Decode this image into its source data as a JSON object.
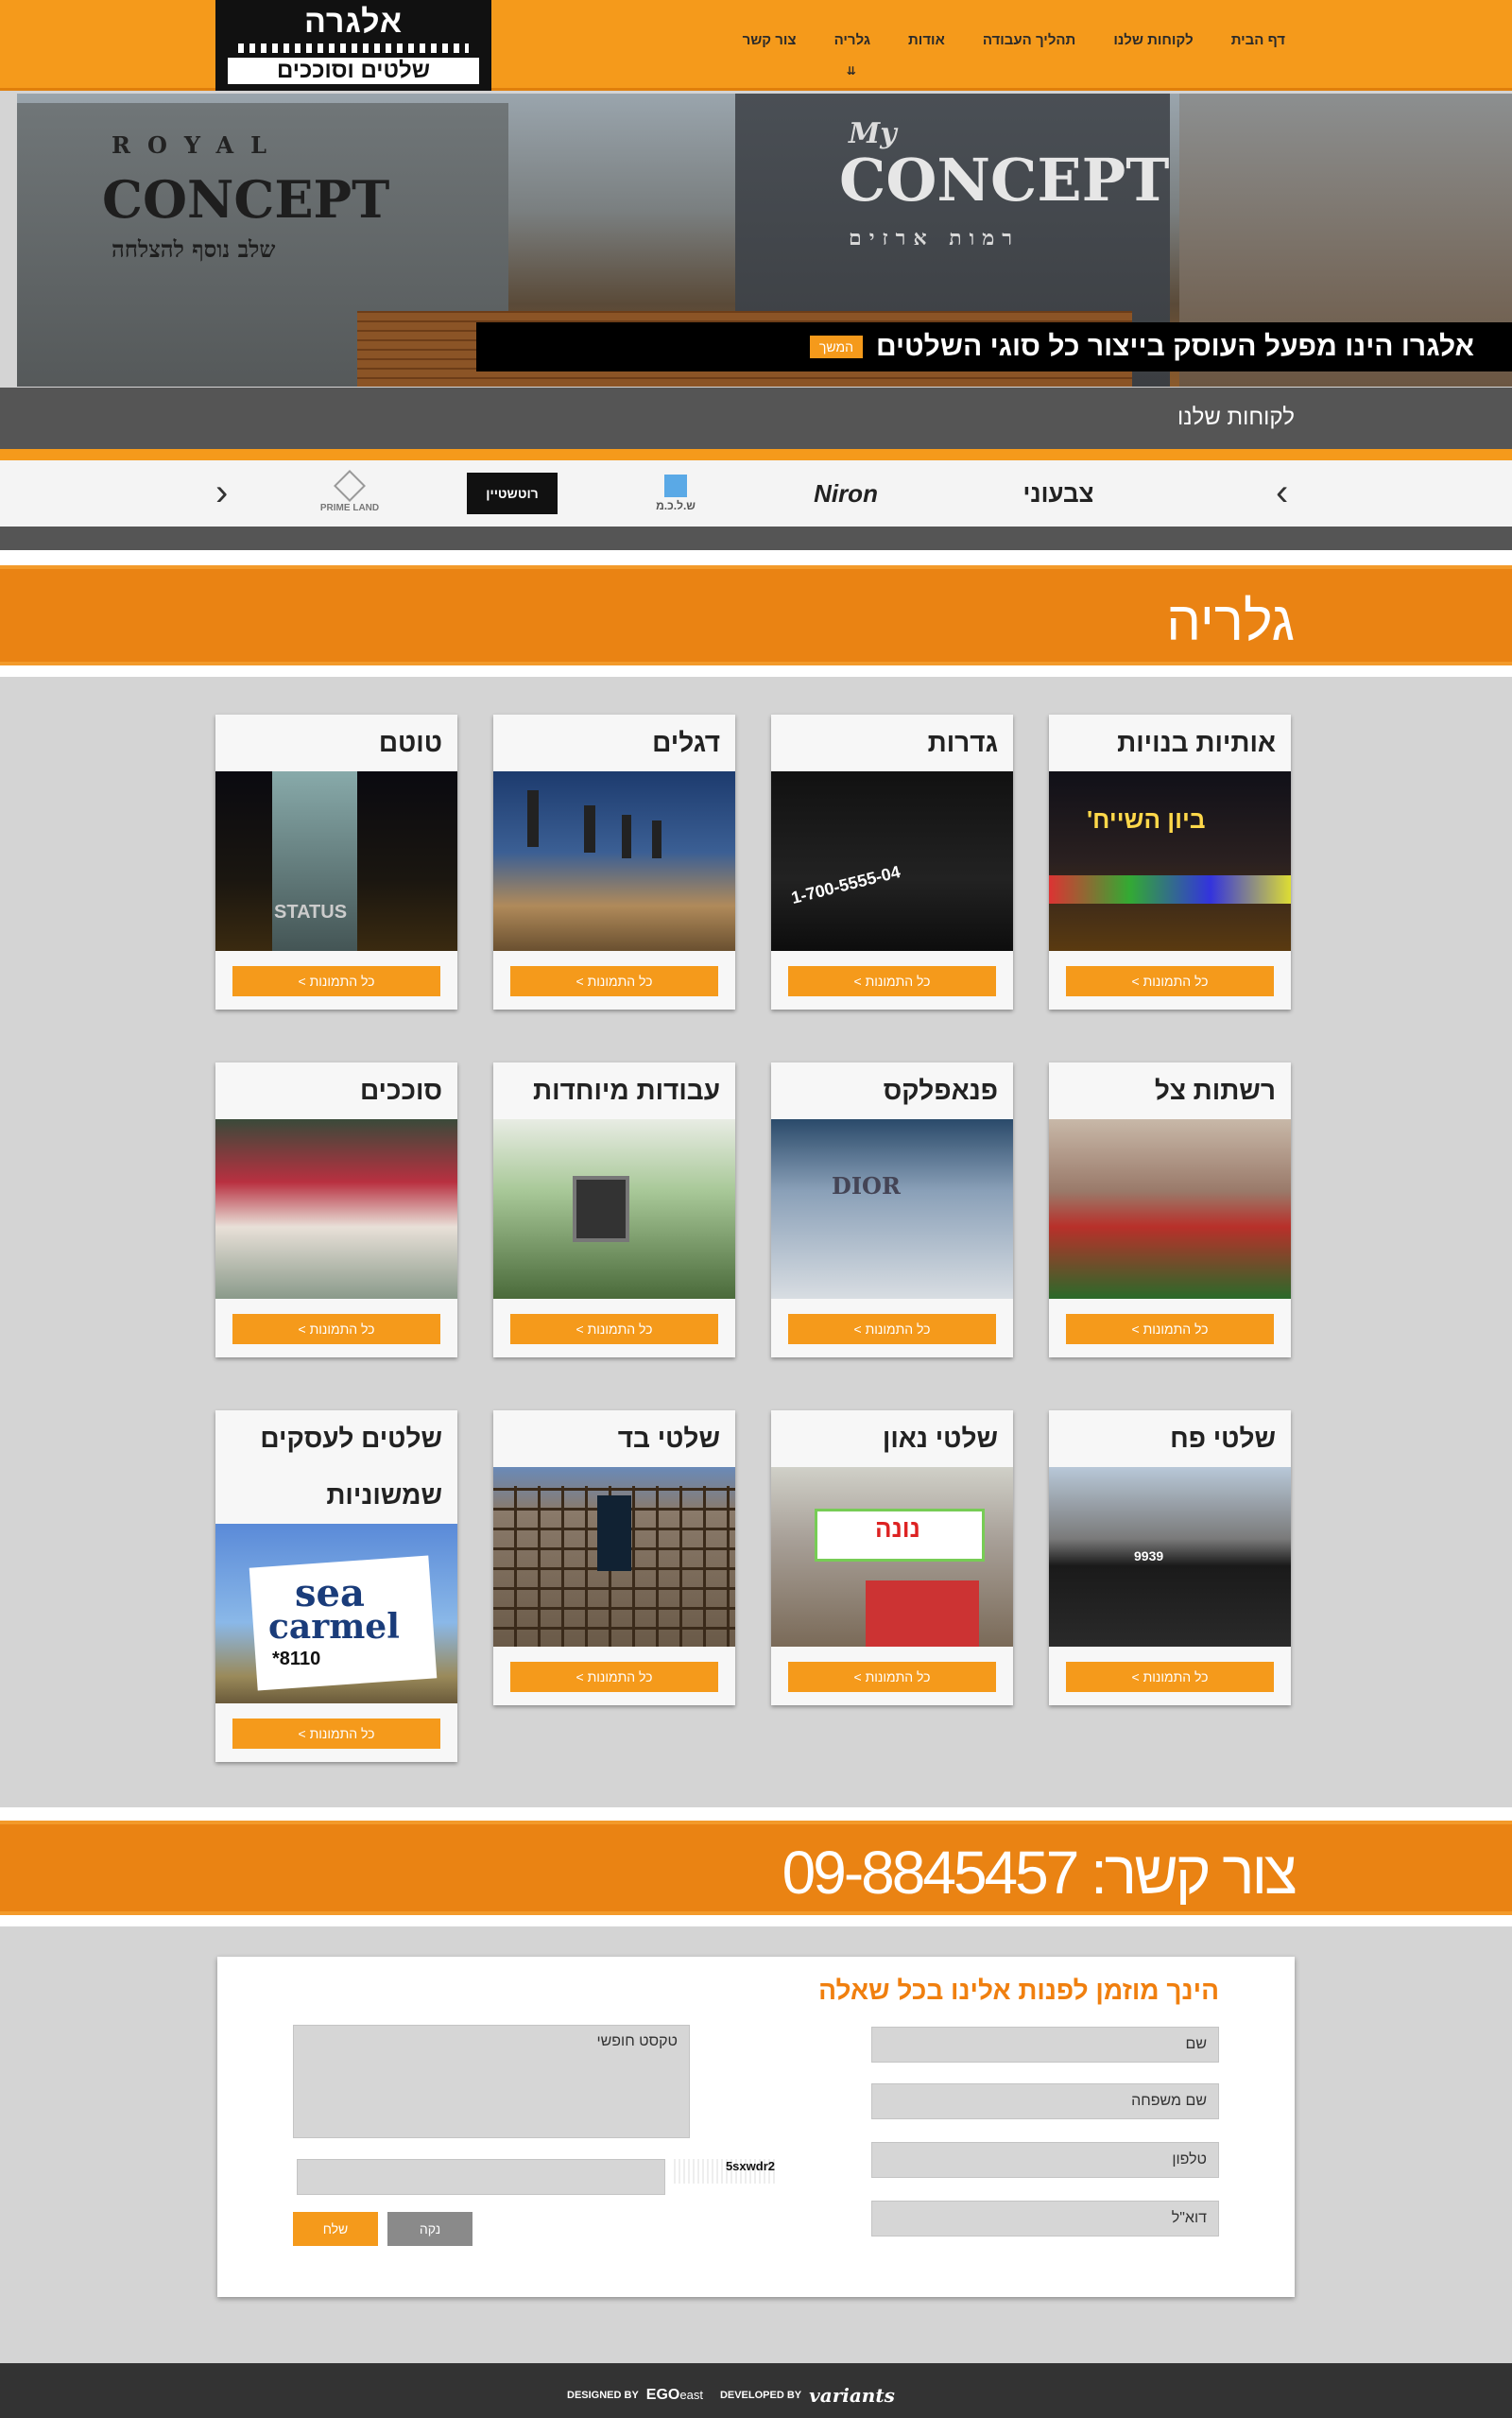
{
  "header": {
    "logo_top": "אלגרה",
    "logo_bottom": "שלטים וסוככים",
    "nav": [
      {
        "label": "דף הבית"
      },
      {
        "label": "לקוחות שלנו"
      },
      {
        "label": "תהליך העבודה"
      },
      {
        "label": "אודות"
      },
      {
        "label": "גלריה",
        "active": true
      },
      {
        "label": "צור קשר"
      }
    ]
  },
  "hero": {
    "sign_royal": "ROYAL",
    "sign_concept1": "CONCEPT",
    "sign_tag1": "שלב נוסף להצלחה",
    "sign_my": "My",
    "sign_concept2": "CONCEPT",
    "sign_tag2": "רמות ארזים",
    "caption": "אלגרו הינו מפעל העוסק בייצור כל סוגי השלטים",
    "more_label": "המשך"
  },
  "clients": {
    "title": "לקוחות שלנו",
    "logos": [
      {
        "text": "PRIME LAND"
      },
      {
        "text": "רוטשטיין"
      },
      {
        "text": "ש.ל.כ.מ"
      },
      {
        "text": "Niron"
      },
      {
        "text": "צבעוני"
      }
    ]
  },
  "gallery": {
    "title": "גלריה",
    "button_label": "כל התמונות >",
    "items": [
      {
        "title": "אותיות בנויות"
      },
      {
        "title": "גדרות"
      },
      {
        "title": "דגלים"
      },
      {
        "title": "טוטם"
      },
      {
        "title": "רשתות צל"
      },
      {
        "title": "פנאפלקס"
      },
      {
        "title": "עבודות מיוחדות"
      },
      {
        "title": "סוככים"
      },
      {
        "title": "שלטי פח"
      },
      {
        "title": "שלטי נאון"
      },
      {
        "title": "שלטי בד"
      },
      {
        "title": "שלטים לעסקים שמשוניות"
      }
    ],
    "img_text": {
      "shop": "ביון השייח'",
      "fence": "1-700-5555-04",
      "totem": "STATUS",
      "studio": "DIOR",
      "neon": "נונה",
      "bill_1": "sea",
      "bill_2": "carmel",
      "bill_3": "8110*",
      "fence2": "9939"
    }
  },
  "contact": {
    "title": "צור קשר: 09-8845457",
    "form_title": "הינך מוזמן לפנות אלינו בכל שאלה",
    "fields": {
      "first_name": "שם",
      "last_name": "שם משפחה",
      "phone": "טלפון",
      "email": "דוא\"ל",
      "free_text": "טקסט חופשי"
    },
    "captcha": "5sxwdr2",
    "send_label": "שלח",
    "clear_label": "נקה"
  },
  "footer": {
    "designed_by": "DESIGNED BY",
    "ego": "EGO",
    "ego_east": "east",
    "developed_by": "DEVELOPED BY",
    "variants": "variants"
  },
  "colors": {
    "accent": "#f59a1b",
    "banner": "#ea8313",
    "dark_bar": "#555555",
    "page_bg": "#d4d4d4"
  }
}
